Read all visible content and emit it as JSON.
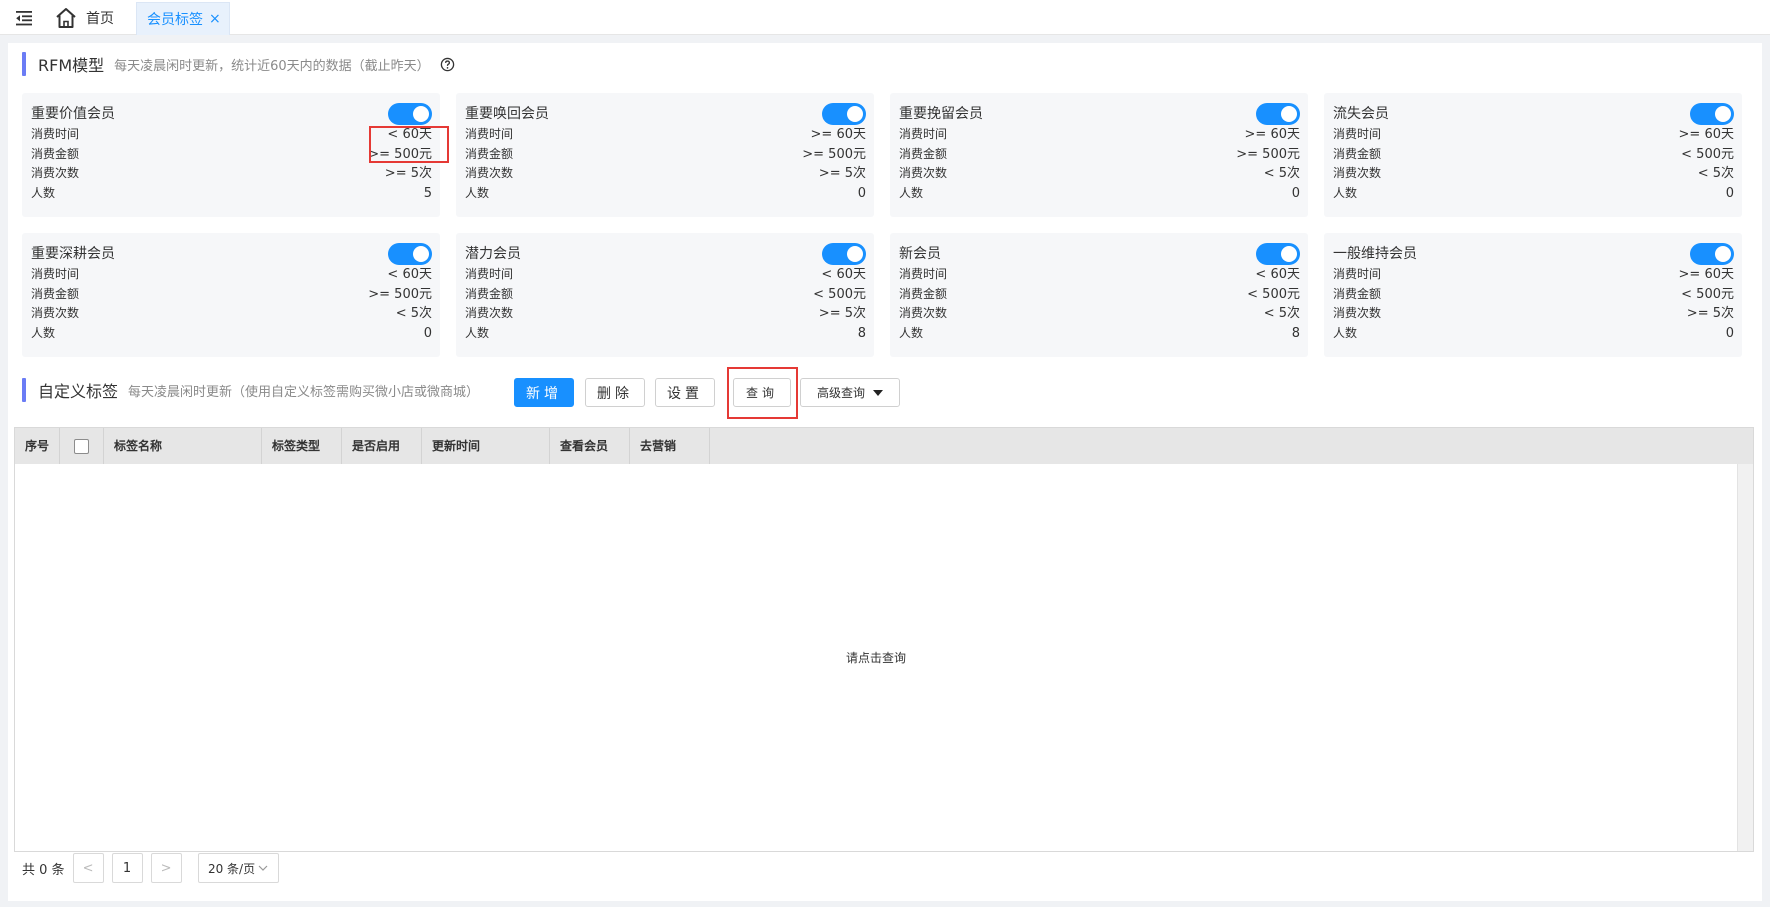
{
  "topbar": {
    "home_label": "首页",
    "active_tab_label": "会员标签",
    "close_glyph": "×"
  },
  "rfm": {
    "title": "RFM模型",
    "desc": "每天凌晨闲时更新，统计近60天内的数据（截止昨天）",
    "row_labels": [
      "消费时间",
      "消费金额",
      "消费次数",
      "人数"
    ],
    "cards": [
      {
        "name": "重要价值会员",
        "enabled": true,
        "values": [
          "< 60天",
          ">= 500元",
          ">= 5次",
          "5"
        ]
      },
      {
        "name": "重要唤回会员",
        "enabled": true,
        "values": [
          ">= 60天",
          ">= 500元",
          ">= 5次",
          "0"
        ]
      },
      {
        "name": "重要挽留会员",
        "enabled": true,
        "values": [
          ">= 60天",
          ">= 500元",
          "< 5次",
          "0"
        ]
      },
      {
        "name": "流失会员",
        "enabled": true,
        "values": [
          ">= 60天",
          "< 500元",
          "< 5次",
          "0"
        ]
      },
      {
        "name": "重要深耕会员",
        "enabled": true,
        "values": [
          "< 60天",
          ">= 500元",
          "< 5次",
          "0"
        ]
      },
      {
        "name": "潜力会员",
        "enabled": true,
        "values": [
          "< 60天",
          "< 500元",
          ">= 5次",
          "8"
        ]
      },
      {
        "name": "新会员",
        "enabled": true,
        "values": [
          "< 60天",
          "< 500元",
          "< 5次",
          "8"
        ]
      },
      {
        "name": "一般维持会员",
        "enabled": true,
        "values": [
          ">= 60天",
          "< 500元",
          ">= 5次",
          "0"
        ]
      }
    ]
  },
  "custom": {
    "title": "自定义标签",
    "desc": "每天凌晨闲时更新（使用自定义标签需购买微小店或微商城）",
    "btn_add": "新增",
    "btn_delete": "删除",
    "btn_settings": "设置",
    "btn_query": "查询",
    "btn_advanced": "高级查询"
  },
  "table": {
    "columns": [
      "序号",
      "",
      "标签名称",
      "标签类型",
      "是否启用",
      "更新时间",
      "查看会员",
      "去营销"
    ],
    "empty_text": "请点击查询"
  },
  "pager": {
    "total_text": "共 0 条",
    "prev": "<",
    "page": "1",
    "next": ">",
    "page_size": "20 条/页"
  },
  "colors": {
    "accent": "#1890ff",
    "section_bar": "#6b7cf5",
    "highlight": "#e53935"
  }
}
